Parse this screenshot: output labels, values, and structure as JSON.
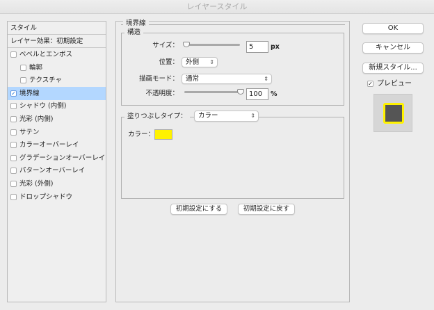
{
  "window": {
    "title": "レイヤースタイル"
  },
  "sidebar": {
    "header": "スタイル",
    "preset": "レイヤー効果：初期設定",
    "items": [
      {
        "label": "ベベルとエンボス",
        "checked": false,
        "indent": false
      },
      {
        "label": "輪郭",
        "checked": false,
        "indent": true
      },
      {
        "label": "テクスチャ",
        "checked": false,
        "indent": true
      },
      {
        "label": "境界線",
        "checked": true,
        "indent": false,
        "selected": true
      },
      {
        "label": "シャドウ (内側)",
        "checked": false,
        "indent": false
      },
      {
        "label": "光彩 (内側)",
        "checked": false,
        "indent": false
      },
      {
        "label": "サテン",
        "checked": false,
        "indent": false
      },
      {
        "label": "カラーオーバーレイ",
        "checked": false,
        "indent": false
      },
      {
        "label": "グラデーションオーバーレイ",
        "checked": false,
        "indent": false
      },
      {
        "label": "パターンオーバーレイ",
        "checked": false,
        "indent": false
      },
      {
        "label": "光彩 (外側)",
        "checked": false,
        "indent": false
      },
      {
        "label": "ドロップシャドウ",
        "checked": false,
        "indent": false
      }
    ]
  },
  "stroke": {
    "title": "境界線",
    "structure": {
      "title": "構造",
      "size_label": "サイズ：",
      "size_value": "5",
      "size_unit": "px",
      "position_label": "位置：",
      "position_value": "外側",
      "blend_label": "描画モード：",
      "blend_value": "通常",
      "opacity_label": "不透明度：",
      "opacity_value": "100",
      "opacity_unit": "%",
      "opacity_fraction": 1.0
    },
    "fill": {
      "type_label": "塗りつぶしタイプ：",
      "type_value": "カラー",
      "color_label": "カラー：",
      "color": "#fff200"
    },
    "reset_default": "初期設定にする",
    "restore_default": "初期設定に戻す"
  },
  "actions": {
    "ok": "OK",
    "cancel": "キャンセル",
    "new_style": "新規スタイル...",
    "preview_label": "プレビュー",
    "preview_checked": true
  },
  "preview": {
    "fill_color": "#555555",
    "stroke_color": "#fff200"
  }
}
